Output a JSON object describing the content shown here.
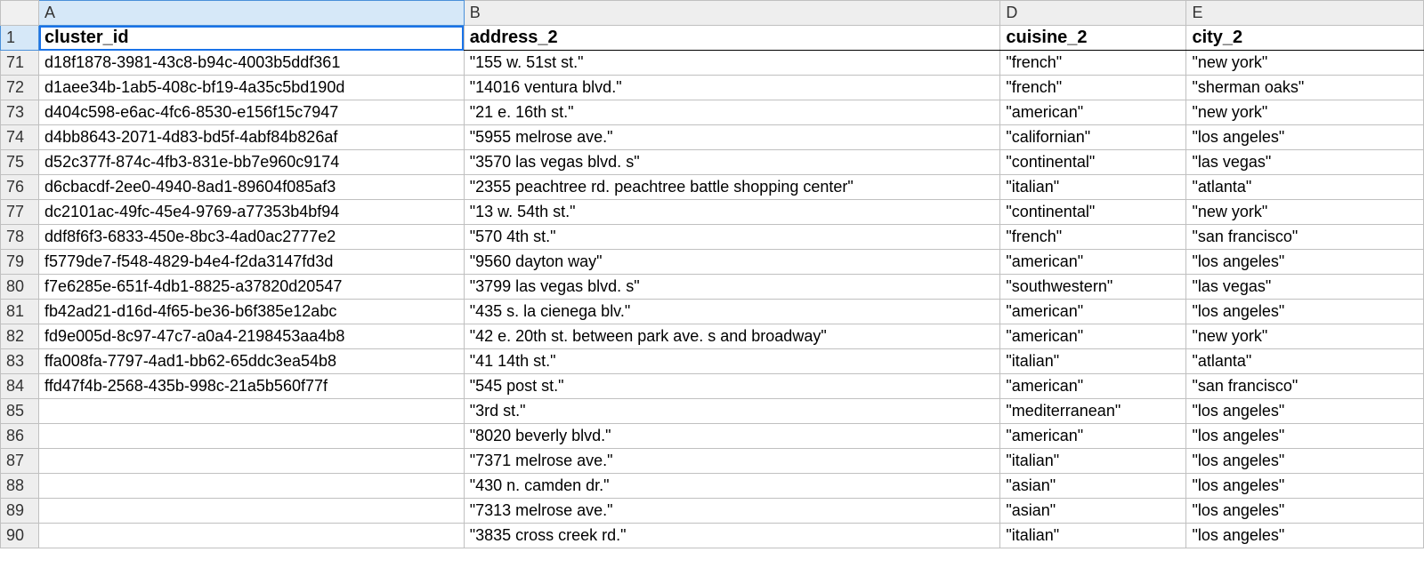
{
  "columns": {
    "A": "A",
    "B": "B",
    "D": "D",
    "E": "E"
  },
  "headers": {
    "A": "cluster_id",
    "B": "address_2",
    "D": "cuisine_2",
    "E": "city_2"
  },
  "header_row_number": "1",
  "rows": [
    {
      "n": "71",
      "A": "d18f1878-3981-43c8-b94c-4003b5ddf361",
      "B": "\"155 w. 51st st.\"",
      "D": "\"french\"",
      "E": "\"new york\""
    },
    {
      "n": "72",
      "A": "d1aee34b-1ab5-408c-bf19-4a35c5bd190d",
      "B": "\"14016 ventura blvd.\"",
      "D": "\"french\"",
      "E": "\"sherman oaks\""
    },
    {
      "n": "73",
      "A": "d404c598-e6ac-4fc6-8530-e156f15c7947",
      "B": "\"21 e. 16th st.\"",
      "D": "\"american\"",
      "E": "\"new york\""
    },
    {
      "n": "74",
      "A": "d4bb8643-2071-4d83-bd5f-4abf84b826af",
      "B": "\"5955 melrose ave.\"",
      "D": "\"californian\"",
      "E": "\"los angeles\""
    },
    {
      "n": "75",
      "A": "d52c377f-874c-4fb3-831e-bb7e960c9174",
      "B": "\"3570 las vegas blvd. s\"",
      "D": "\"continental\"",
      "E": "\"las vegas\""
    },
    {
      "n": "76",
      "A": "d6cbacdf-2ee0-4940-8ad1-89604f085af3",
      "B": "\"2355 peachtree rd.  peachtree battle shopping center\"",
      "D": "\"italian\"",
      "E": "\"atlanta\""
    },
    {
      "n": "77",
      "A": "dc2101ac-49fc-45e4-9769-a77353b4bf94",
      "B": "\"13 w. 54th st.\"",
      "D": "\"continental\"",
      "E": "\"new york\""
    },
    {
      "n": "78",
      "A": "ddf8f6f3-6833-450e-8bc3-4ad0ac2777e2",
      "B": "\"570 4th st.\"",
      "D": "\"french\"",
      "E": "\"san francisco\""
    },
    {
      "n": "79",
      "A": "f5779de7-f548-4829-b4e4-f2da3147fd3d",
      "B": "\"9560 dayton way\"",
      "D": "\"american\"",
      "E": "\"los angeles\""
    },
    {
      "n": "80",
      "A": "f7e6285e-651f-4db1-8825-a37820d20547",
      "B": "\"3799 las vegas blvd. s\"",
      "D": "\"southwestern\"",
      "E": "\"las vegas\""
    },
    {
      "n": "81",
      "A": "fb42ad21-d16d-4f65-be36-b6f385e12abc",
      "B": "\"435 s. la cienega blv.\"",
      "D": "\"american\"",
      "E": "\"los angeles\""
    },
    {
      "n": "82",
      "A": "fd9e005d-8c97-47c7-a0a4-2198453aa4b8",
      "B": "\"42 e. 20th st.  between park ave. s and broadway\"",
      "D": "\"american\"",
      "E": "\"new york\""
    },
    {
      "n": "83",
      "A": "ffa008fa-7797-4ad1-bb62-65ddc3ea54b8",
      "B": "\"41 14th st.\"",
      "D": "\"italian\"",
      "E": "\"atlanta\""
    },
    {
      "n": "84",
      "A": "ffd47f4b-2568-435b-998c-21a5b560f77f",
      "B": "\"545 post st.\"",
      "D": "\"american\"",
      "E": "\"san francisco\""
    },
    {
      "n": "85",
      "A": "",
      "B": "\"3rd st.\"",
      "D": "\"mediterranean\"",
      "E": "\"los angeles\""
    },
    {
      "n": "86",
      "A": "",
      "B": "\"8020 beverly blvd.\"",
      "D": "\"american\"",
      "E": "\"los angeles\""
    },
    {
      "n": "87",
      "A": "",
      "B": "\"7371 melrose ave.\"",
      "D": "\"italian\"",
      "E": "\"los angeles\""
    },
    {
      "n": "88",
      "A": "",
      "B": "\"430 n. camden dr.\"",
      "D": "\"asian\"",
      "E": "\"los angeles\""
    },
    {
      "n": "89",
      "A": "",
      "B": "\"7313 melrose ave.\"",
      "D": "\"asian\"",
      "E": "\"los angeles\""
    },
    {
      "n": "90",
      "A": "",
      "B": "\"3835 cross creek rd.\"",
      "D": "\"italian\"",
      "E": "\"los angeles\""
    }
  ]
}
